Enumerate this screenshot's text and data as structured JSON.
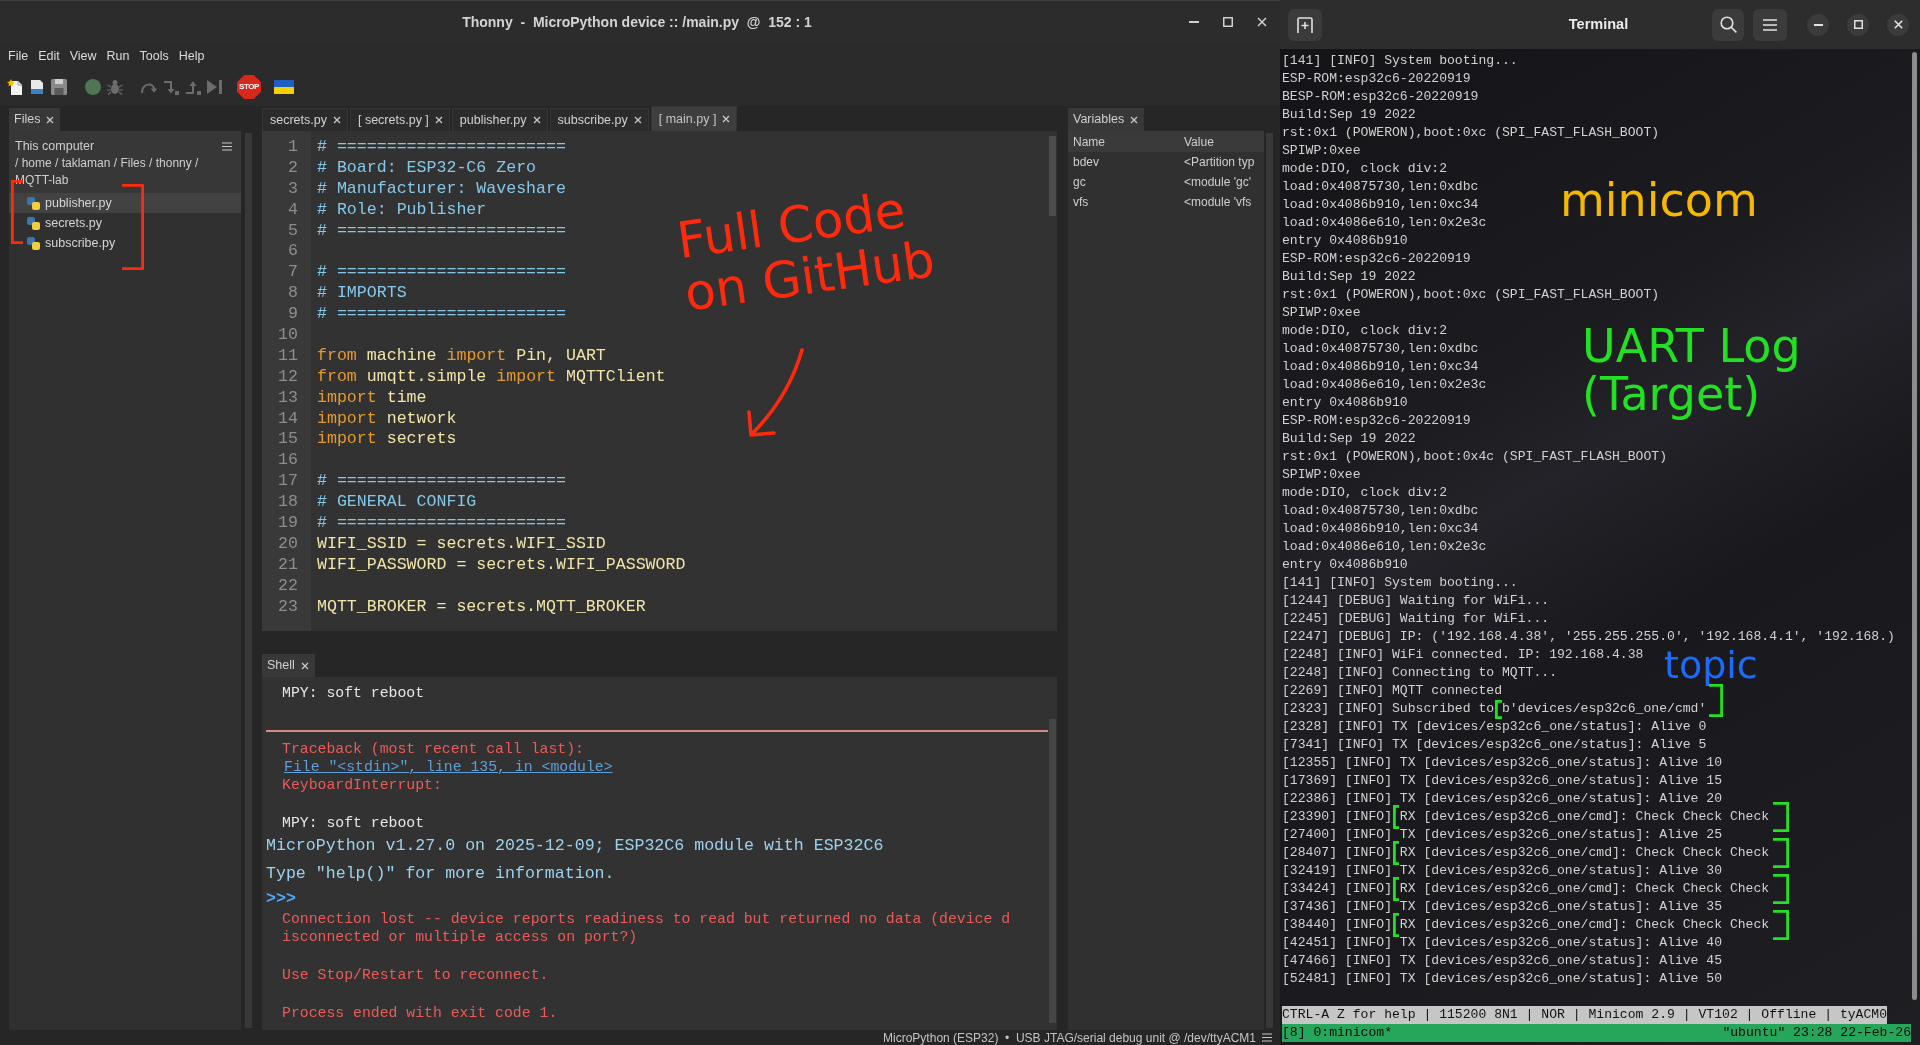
{
  "thonny": {
    "title": "Thonny  -  MicroPython device :: /main.py  @  152 : 1",
    "menu": [
      "File",
      "Edit",
      "View",
      "Run",
      "Tools",
      "Help"
    ],
    "toolbar": [
      {
        "kind": "new",
        "disabled": false
      },
      {
        "kind": "open",
        "disabled": false
      },
      {
        "kind": "save",
        "disabled": false
      },
      {
        "kind": "run",
        "disabled": true
      },
      {
        "kind": "debug",
        "disabled": true
      },
      {
        "kind": "step_over",
        "disabled": true
      },
      {
        "kind": "step_into",
        "disabled": true
      },
      {
        "kind": "step_out",
        "disabled": true
      },
      {
        "kind": "resume",
        "disabled": true
      },
      {
        "kind": "stop",
        "label": "STOP",
        "disabled": false
      },
      {
        "kind": "flag",
        "disabled": false
      }
    ],
    "files": {
      "tab": "Files",
      "location": "This computer",
      "path": "/ home / taklaman / Files / thonny / MQTT-lab",
      "items": [
        {
          "name": "publisher.py",
          "selected": true
        },
        {
          "name": "secrets.py",
          "selected": false
        },
        {
          "name": "subscribe.py",
          "selected": false
        }
      ]
    },
    "editor": {
      "tabs": [
        {
          "label": "secrets.py",
          "selected": false
        },
        {
          "label": "[ secrets.py ]",
          "selected": false
        },
        {
          "label": "publisher.py",
          "selected": false
        },
        {
          "label": "subscribe.py",
          "selected": false
        },
        {
          "label": "[ main.py ]",
          "selected": true
        }
      ],
      "lines": [
        {
          "number": "1",
          "tokens": [
            {
              "kind": "comment",
              "text": "# ======================="
            }
          ]
        },
        {
          "number": "2",
          "tokens": [
            {
              "kind": "comment",
              "text": "# Board: ESP32-C6 Zero"
            }
          ]
        },
        {
          "number": "3",
          "tokens": [
            {
              "kind": "comment",
              "text": "# Manufacturer: Waveshare"
            }
          ]
        },
        {
          "number": "4",
          "tokens": [
            {
              "kind": "comment",
              "text": "# Role: Publisher"
            }
          ]
        },
        {
          "number": "5",
          "tokens": [
            {
              "kind": "comment",
              "text": "# ======================="
            }
          ]
        },
        {
          "number": "6"
        },
        {
          "number": "7",
          "tokens": [
            {
              "kind": "comment",
              "text": "# ======================="
            }
          ]
        },
        {
          "number": "8",
          "tokens": [
            {
              "kind": "comment",
              "text": "# IMPORTS"
            }
          ]
        },
        {
          "number": "9",
          "tokens": [
            {
              "kind": "comment",
              "text": "# ======================="
            }
          ]
        },
        {
          "number": "10"
        },
        {
          "number": "11",
          "tokens": [
            {
              "kind": "keyword",
              "text": "from"
            },
            {
              "kind": "text",
              "text": " machine "
            },
            {
              "kind": "keyword",
              "text": "import"
            },
            {
              "kind": "text",
              "text": " Pin, UART"
            }
          ]
        },
        {
          "number": "12",
          "tokens": [
            {
              "kind": "keyword",
              "text": "from"
            },
            {
              "kind": "text",
              "text": " umqtt.simple "
            },
            {
              "kind": "keyword",
              "text": "import"
            },
            {
              "kind": "text",
              "text": " MQTTClient"
            }
          ]
        },
        {
          "number": "13",
          "tokens": [
            {
              "kind": "keyword",
              "text": "import"
            },
            {
              "kind": "text",
              "text": " time"
            }
          ]
        },
        {
          "number": "14",
          "tokens": [
            {
              "kind": "keyword",
              "text": "import"
            },
            {
              "kind": "text",
              "text": " network"
            }
          ]
        },
        {
          "number": "15",
          "tokens": [
            {
              "kind": "keyword",
              "text": "import"
            },
            {
              "kind": "text",
              "text": " secrets"
            }
          ]
        },
        {
          "number": "16"
        },
        {
          "number": "17",
          "tokens": [
            {
              "kind": "comment",
              "text": "# ======================="
            }
          ]
        },
        {
          "number": "18",
          "tokens": [
            {
              "kind": "comment",
              "text": "# GENERAL CONFIG"
            }
          ]
        },
        {
          "number": "19",
          "tokens": [
            {
              "kind": "comment",
              "text": "# ======================="
            }
          ]
        },
        {
          "number": "20",
          "tokens": [
            {
              "kind": "text",
              "text": "WIFI_SSID = secrets.WIFI_SSID"
            }
          ]
        },
        {
          "number": "21",
          "tokens": [
            {
              "kind": "text",
              "text": "WIFI_PASSWORD = secrets.WIFI_PASSWORD"
            }
          ]
        },
        {
          "number": "22"
        },
        {
          "number": "23",
          "tokens": [
            {
              "kind": "text",
              "text": "MQTT_BROKER = secrets.MQTT_BROKER"
            }
          ]
        }
      ]
    },
    "shell": {
      "tab": "Shell",
      "blocks": [
        {
          "lines": [
            {
              "kind": "output",
              "text": "MPY: soft reboot"
            }
          ]
        },
        {
          "lines": [
            {
              "kind": "rule"
            },
            {
              "kind": "error",
              "text": "Traceback (most recent call last):"
            },
            {
              "kind": "link",
              "text": "File \"<stdin>\", line 135, in <module>"
            },
            {
              "kind": "error",
              "text": "KeyboardInterrupt:"
            }
          ]
        },
        {
          "lines": [
            {
              "kind": "output",
              "text": "MPY: soft reboot"
            },
            {
              "kind": "banner",
              "text": "MicroPython v1.27.0 on 2025-12-09; ESP32C6 module with ESP32C6"
            },
            {
              "kind": "banner",
              "text": "Type \"help()\" for more information."
            },
            {
              "kind": "prompt",
              "text": ">>>"
            },
            {
              "kind": "error",
              "text": "Connection lost -- device reports readiness to read but returned no data (device d"
            },
            {
              "kind": "error",
              "text": "isconnected or multiple access on port?)"
            }
          ]
        },
        {
          "lines": [
            {
              "kind": "error",
              "text": "Use Stop/Restart to reconnect."
            }
          ]
        },
        {
          "lines": [
            {
              "kind": "error",
              "text": "Process ended with exit code 1."
            }
          ]
        }
      ]
    },
    "variables": {
      "tab": "Variables",
      "columns": [
        "Name",
        "Value"
      ],
      "rows": [
        {
          "name": "bdev",
          "value": "<Partition typ"
        },
        {
          "name": "gc",
          "value": "<module 'gc'"
        },
        {
          "name": "vfs",
          "value": "<module 'vfs"
        }
      ]
    },
    "status_bar": "MicroPython (ESP32)  •  USB JTAG/serial debug unit @ /dev/ttyACM1"
  },
  "terminal": {
    "title": "Terminal",
    "lines": [
      "[141] [INFO] System booting...",
      "ESP-ROM:esp32c6-20220919",
      "BESP-ROM:esp32c6-20220919",
      "Build:Sep 19 2022",
      "rst:0x1 (POWERON),boot:0xc (SPI_FAST_FLASH_BOOT)",
      "SPIWP:0xee",
      "mode:DIO, clock div:2",
      "load:0x40875730,len:0xdbc",
      "load:0x4086b910,len:0xc34",
      "load:0x4086e610,len:0x2e3c",
      "entry 0x4086b910",
      "ESP-ROM:esp32c6-20220919",
      "Build:Sep 19 2022",
      "rst:0x1 (POWERON),boot:0xc (SPI_FAST_FLASH_BOOT)",
      "SPIWP:0xee",
      "mode:DIO, clock div:2",
      "load:0x40875730,len:0xdbc",
      "load:0x4086b910,len:0xc34",
      "load:0x4086e610,len:0x2e3c",
      "entry 0x4086b910",
      "ESP-ROM:esp32c6-20220919",
      "Build:Sep 19 2022",
      "rst:0x1 (POWERON),boot:0x4c (SPI_FAST_FLASH_BOOT)",
      "SPIWP:0xee",
      "mode:DIO, clock div:2",
      "load:0x40875730,len:0xdbc",
      "load:0x4086b910,len:0xc34",
      "load:0x4086e610,len:0x2e3c",
      "entry 0x4086b910",
      "[141] [INFO] System booting...",
      "[1244] [DEBUG] Waiting for WiFi...",
      "[2245] [DEBUG] Waiting for WiFi...",
      "[2247] [DEBUG] IP: ('192.168.4.38', '255.255.255.0', '192.168.4.1', '192.168.)",
      "[2248] [INFO] WiFi connected. IP: 192.168.4.38",
      "[2248] [INFO] Connecting to MQTT...",
      "[2269] [INFO] MQTT connected",
      "[2323] [INFO] Subscribed to b'devices/esp32c6_one/cmd'",
      "[2328] [INFO] TX [devices/esp32c6_one/status]: Alive 0",
      "[7341] [INFO] TX [devices/esp32c6_one/status]: Alive 5",
      "[12355] [INFO] TX [devices/esp32c6_one/status]: Alive 10",
      "[17369] [INFO] TX [devices/esp32c6_one/status]: Alive 15",
      "[22386] [INFO] TX [devices/esp32c6_one/status]: Alive 20",
      "[23390] [INFO] RX [devices/esp32c6_one/cmd]: Check Check Check",
      "[27400] [INFO] TX [devices/esp32c6_one/status]: Alive 25",
      "[28407] [INFO] RX [devices/esp32c6_one/cmd]: Check Check Check",
      "[32419] [INFO] TX [devices/esp32c6_one/status]: Alive 30",
      "[33424] [INFO] RX [devices/esp32c6_one/cmd]: Check Check Check",
      "[37436] [INFO] TX [devices/esp32c6_one/status]: Alive 35",
      "[38440] [INFO] RX [devices/esp32c6_one/cmd]: Check Check Check",
      "[42451] [INFO] TX [devices/esp32c6_one/status]: Alive 40",
      "[47466] [INFO] TX [devices/esp32c6_one/status]: Alive 45",
      "[52481] [INFO] TX [devices/esp32c6_one/status]: Alive 50"
    ],
    "minicom_status": "CTRL-A Z for help | 115200 8N1 | NOR | Minicom 2.9 | VT102 | Offline | tyACM0",
    "tmux_status": {
      "window": "[8] 0:minicom*",
      "host_clock": "\"ubuntu\" 23:28 22-Feb-26"
    }
  },
  "annotations": [
    {
      "kind": "note",
      "text": "Full Code on GitHub",
      "color": "#ff2a0e"
    },
    {
      "kind": "arrow",
      "color": "#ff2a0e"
    },
    {
      "kind": "left-bracket",
      "color": "#ff2a0e"
    },
    {
      "kind": "right-bracket",
      "color": "#ff2a0e"
    },
    {
      "kind": "note",
      "text": "minicom",
      "color": "#f5b800"
    },
    {
      "kind": "note",
      "text": "UART Log (Target)",
      "color": "#22e022"
    },
    {
      "kind": "note",
      "text": "topic",
      "color": "#1a6cff"
    },
    {
      "kind": "left-bracket",
      "color": "#22e022"
    },
    {
      "kind": "right-bracket",
      "color": "#22e022"
    },
    {
      "kind": "left-bracket",
      "color": "#22e022"
    },
    {
      "kind": "right-bracket",
      "color": "#22e022"
    },
    {
      "kind": "left-bracket",
      "color": "#22e022"
    },
    {
      "kind": "right-bracket",
      "color": "#22e022"
    },
    {
      "kind": "left-bracket",
      "color": "#22e022"
    },
    {
      "kind": "right-bracket",
      "color": "#22e022"
    },
    {
      "kind": "left-bracket",
      "color": "#22e022"
    },
    {
      "kind": "right-bracket",
      "color": "#22e022"
    }
  ]
}
